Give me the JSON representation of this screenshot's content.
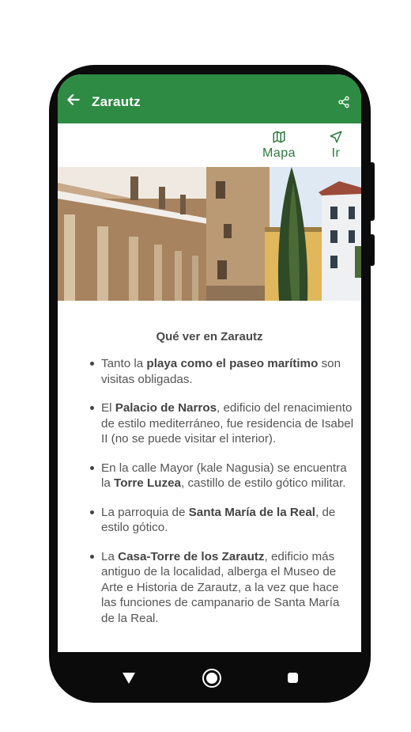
{
  "appbar": {
    "title": "Zarautz"
  },
  "actions": {
    "map_label": "Mapa",
    "go_label": "Ir"
  },
  "content": {
    "section_title": "Qué ver en Zarautz",
    "items": [
      {
        "parts": [
          {
            "t": "Tanto la "
          },
          {
            "t": "playa como el paseo marítimo",
            "b": true
          },
          {
            "t": " son visitas obligadas."
          }
        ]
      },
      {
        "parts": [
          {
            "t": "El "
          },
          {
            "t": "Palacio de Narros",
            "b": true
          },
          {
            "t": ", edificio del renacimiento de estilo mediterráneo, fue residencia de Isabel II (no se puede visitar el interior)."
          }
        ]
      },
      {
        "parts": [
          {
            "t": "En la calle Mayor (kale Nagusia) se encuentra la "
          },
          {
            "t": "Torre Luzea",
            "b": true
          },
          {
            "t": ", castillo de estilo gótico militar."
          }
        ]
      },
      {
        "parts": [
          {
            "t": "La parroquia de "
          },
          {
            "t": "Santa María de la Real",
            "b": true
          },
          {
            "t": ", de estilo gótico."
          }
        ]
      },
      {
        "parts": [
          {
            "t": "La "
          },
          {
            "t": "Casa-Torre de los Zarautz",
            "b": true
          },
          {
            "t": ", edificio más antiguo de la localidad, alberga el Museo de Arte e Historia de Zarautz, a la vez que hace las funciones de campanario de Santa María de la Real."
          }
        ]
      }
    ]
  },
  "colors": {
    "primary": "#2e8b43",
    "action_text": "#2e7a3d"
  },
  "icons": {
    "back": "arrow-left-icon",
    "share": "share-icon",
    "map": "map-icon",
    "go": "navigation-icon"
  }
}
